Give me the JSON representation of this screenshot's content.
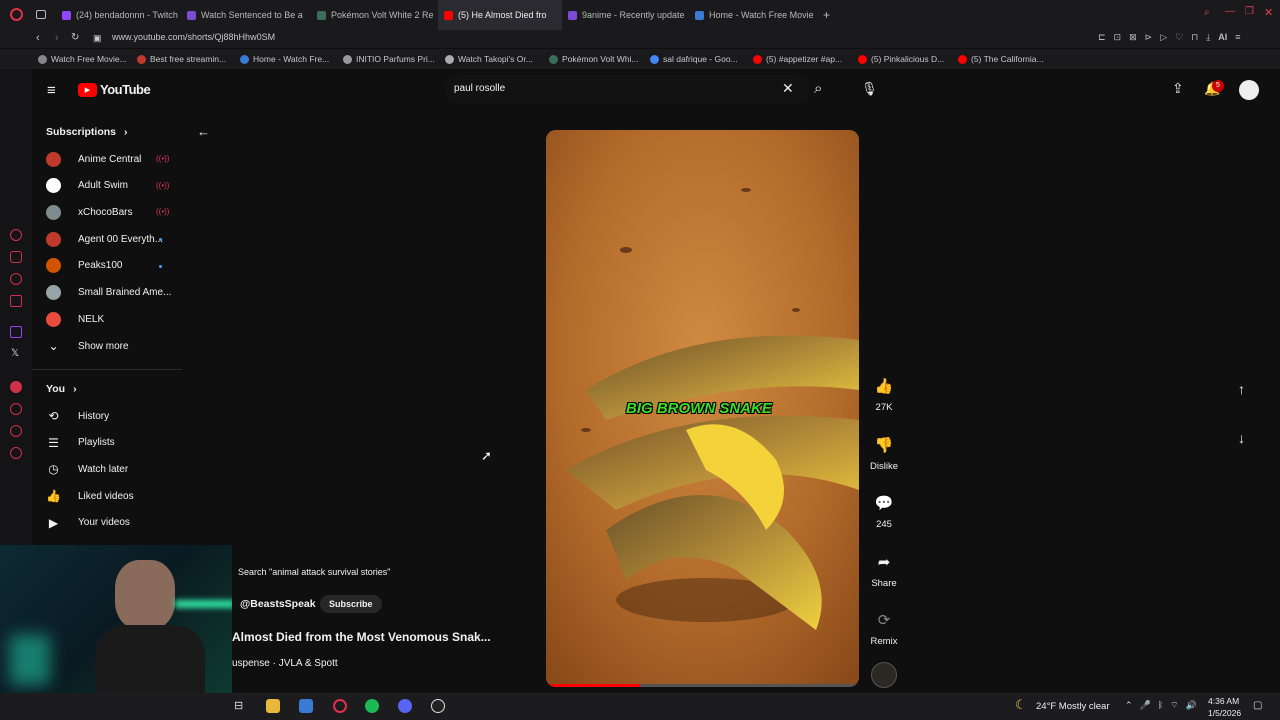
{
  "browser": {
    "tabs": [
      {
        "title": "(24) bendadonnn - Twitch",
        "color": "#9146ff"
      },
      {
        "title": "Watch Sentenced to Be a",
        "color": "#7b4bd6"
      },
      {
        "title": "Pokémon Volt White 2 Re",
        "color": "#3b6e5a"
      },
      {
        "title": "(5) He Almost Died fro",
        "color": "#ff0000",
        "active": true
      },
      {
        "title": "9anime - Recently update",
        "color": "#7b4bd6"
      },
      {
        "title": "Home - Watch Free Movie",
        "color": "#3a7bd5"
      }
    ],
    "url": "www.youtube.com/shorts/Qj88hHhw0SM",
    "bookmarks": [
      "Watch Free Movie...",
      "Best free streamin...",
      "Home - Watch Fre...",
      "INITIO Parfums Pri...",
      "Watch Takopi's Or...",
      "Pokémon Volt Whi...",
      "sal dafrique - Goo...",
      "(5) #appetizer #ap...",
      "(5) Pinkalicious D...",
      "(5) The California..."
    ],
    "aria_label": "AI"
  },
  "youtube": {
    "logo_text": "YouTube",
    "search_value": "paul rosolle",
    "notification_count": "5"
  },
  "sidebar": {
    "subscriptions_heading": "Subscriptions",
    "subscriptions": [
      {
        "name": "Anime Central",
        "status": "live",
        "color": "#c0392b"
      },
      {
        "name": "Adult Swim",
        "status": "live",
        "color": "#ffffff"
      },
      {
        "name": "xChocoBars",
        "status": "live",
        "color": "#7f8c8d"
      },
      {
        "name": "Agent 00 Everyth...",
        "status": "new",
        "color": "#c0392b"
      },
      {
        "name": "Peaks100",
        "status": "new",
        "color": "#d35400"
      },
      {
        "name": "Small Brained Ame...",
        "status": "",
        "color": "#95a5a6"
      },
      {
        "name": "NELK",
        "status": "",
        "color": "#e74c3c"
      }
    ],
    "show_more": "Show more",
    "you_heading": "You",
    "you_items": [
      {
        "label": "History",
        "icon": "history-icon"
      },
      {
        "label": "Playlists",
        "icon": "playlists-icon"
      },
      {
        "label": "Watch later",
        "icon": "clock-icon"
      },
      {
        "label": "Liked videos",
        "icon": "thumbs-up-icon"
      },
      {
        "label": "Your videos",
        "icon": "video-icon"
      }
    ]
  },
  "short": {
    "caption": "BIG BROWN SNAKE",
    "search_suggestion": "Search \"animal attack survival stories\"",
    "channel": "@BeastsSpeak",
    "subscribe_label": "Subscribe",
    "title": "Almost Died from the Most Venomous Snak...",
    "audio": "uspense · JVLA & Spott",
    "likes": "27K",
    "dislike_label": "Dislike",
    "comments": "245",
    "share_label": "Share",
    "remix_label": "Remix"
  },
  "taskbar": {
    "weather": "24°F  Mostly clear",
    "time": "4:36 AM",
    "date": "1/5/2026"
  }
}
